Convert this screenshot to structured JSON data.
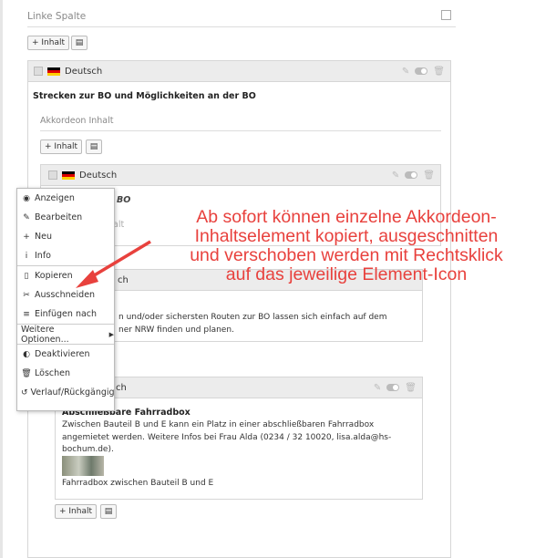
{
  "column_title": "Linke Spalte",
  "toolbar": {
    "add_content_label": "+ Inhalt"
  },
  "outer_element": {
    "language": "Deutsch",
    "title": "Strecken zur BO und Möglichkeiten an der BO",
    "section_label": "Akkordeon Inhalt",
    "add_content_label": "+ Inhalt"
  },
  "inner_element_1": {
    "language": "Deutsch",
    "title_fragment": "BO",
    "sub_fragment": "alt"
  },
  "inner_element_2": {
    "header_fragment": "ch",
    "text_line_1": "n und/oder sichersten Routen zur BO lassen sich einfach auf dem",
    "text_line_2": "ner NRW finden und planen."
  },
  "inner_element_3": {
    "header_fragment": "ch",
    "title": "Abschließbare Fahrradbox",
    "text": "Zwischen Bauteil B und E kann ein Platz in einer abschließbaren Fahrradbox angemietet werden. Weitere Infos bei Frau Alda (0234 / 32 10020, lisa.alda@hs-bochum.de).",
    "image_caption": "Fahrradbox zwischen Bauteil B und E",
    "add_content_label": "+ Inhalt"
  },
  "context_menu": {
    "items": [
      {
        "label": "Anzeigen",
        "icon": "eye-icon"
      },
      {
        "label": "Bearbeiten",
        "icon": "pencil-icon"
      },
      {
        "label": "Neu",
        "icon": "plus-icon"
      },
      {
        "label": "Info",
        "icon": "info-icon"
      },
      {
        "label": "Kopieren",
        "icon": "copy-icon"
      },
      {
        "label": "Ausschneiden",
        "icon": "scissors-icon"
      },
      {
        "label": "Einfügen nach",
        "icon": "paste-icon"
      },
      {
        "label": "Weitere Optionen...",
        "icon": "chevron-right-icon"
      },
      {
        "label": "Deaktivieren",
        "icon": "toggle-icon"
      },
      {
        "label": "Löschen",
        "icon": "trash-icon"
      },
      {
        "label": "Verlauf/Rückgängig",
        "icon": "history-icon"
      }
    ]
  },
  "annotation": {
    "text": "Ab sofort können einzelne Akkordeon-Inhaltselement kopiert, ausgeschnitten und verschoben werden mit Rechtsklick auf das jeweilige Element-Icon",
    "lines": [
      "Ab sofort können einzelne Akkordeon-",
      "Inhaltselement kopiert, ausgeschnitten",
      "und verschoben werden mit Rechtsklick",
      "auf das jeweilige Element-Icon"
    ],
    "color": "#e8413d"
  }
}
